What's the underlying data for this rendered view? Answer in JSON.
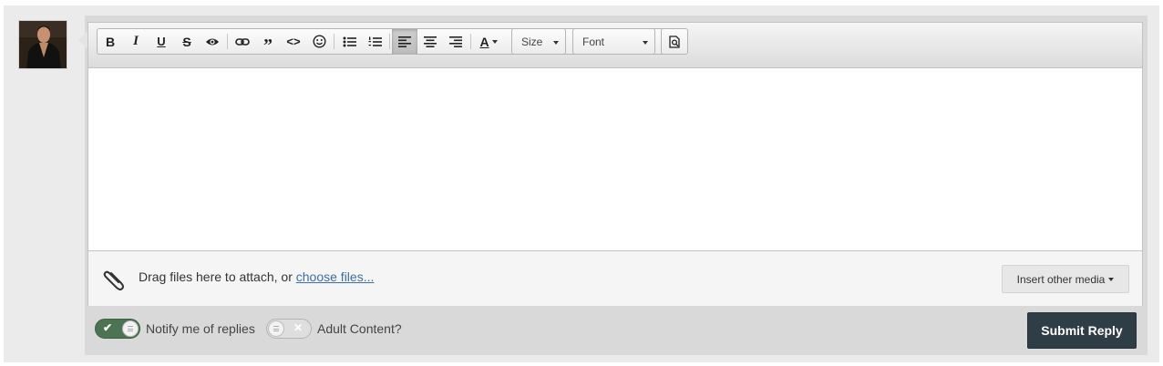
{
  "toolbar": {
    "buttons": [
      {
        "name": "bold",
        "glyph": "B"
      },
      {
        "name": "italic",
        "glyph": "I"
      },
      {
        "name": "underline",
        "glyph": "U"
      },
      {
        "name": "strikethrough",
        "glyph": "S"
      },
      {
        "name": "spoiler",
        "glyph": "eye"
      },
      {
        "name": "link",
        "glyph": "chain"
      },
      {
        "name": "quote",
        "glyph": "99"
      },
      {
        "name": "code",
        "glyph": "<>"
      },
      {
        "name": "emoji",
        "glyph": "smiley"
      },
      {
        "name": "bullet-list",
        "glyph": "ul"
      },
      {
        "name": "numbered-list",
        "glyph": "ol"
      },
      {
        "name": "align-left",
        "glyph": "left",
        "active": true
      },
      {
        "name": "align-center",
        "glyph": "center"
      },
      {
        "name": "align-right",
        "glyph": "right"
      },
      {
        "name": "text-color",
        "glyph": "A"
      }
    ],
    "size_label": "Size",
    "font_label": "Font"
  },
  "attach": {
    "prefix": "Drag files here to attach, or",
    "link": "choose files...",
    "insert_media": "Insert other media"
  },
  "options": {
    "notify_label": "Notify me of replies",
    "notify_on": true,
    "adult_label": "Adult Content?",
    "adult_on": false
  },
  "submit_label": "Submit Reply",
  "colors": {
    "toggle_on": "#4c7352",
    "submit_bg": "#2f3e46",
    "link": "#3c6e9f"
  }
}
